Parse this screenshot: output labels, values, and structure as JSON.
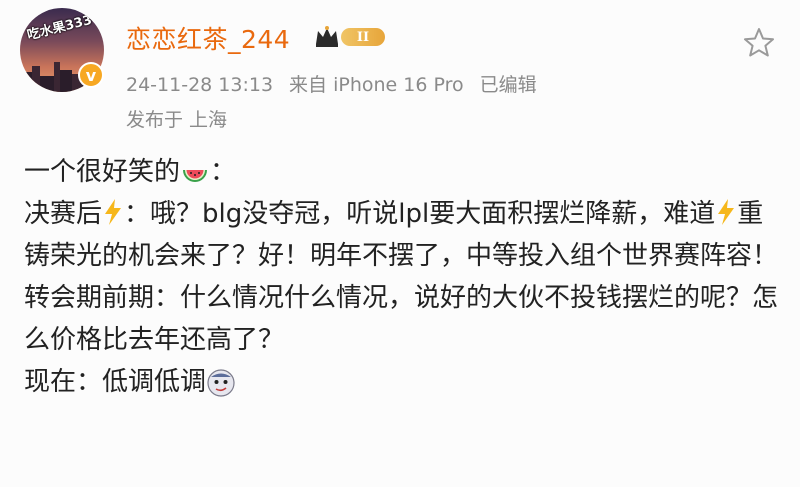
{
  "post": {
    "avatar_text": "吃水果333",
    "username": "恋恋红茶_244",
    "level": "II",
    "verified_mark": "v",
    "date": "24-11-28 13:13",
    "source": "来自 iPhone 16 Pro",
    "edited": "已编辑",
    "location": "发布于 上海"
  },
  "content": {
    "line1_text": "一个很好笑的",
    "line1_suffix": "：",
    "p2_a": "决赛后",
    "p2_b": "：哦？blg没夺冠，听说lpl要大面积摆烂降薪，难道",
    "p2_c": "重铸荣光的机会来了？好！明年不摆了，中等投入组个世界赛阵容！",
    "p3": "转会期前期：什么情况什么情况，说好的大伙不投钱摆烂的呢？怎么价格比去年还高了？",
    "p4": "现在：低调低调"
  },
  "icons": {
    "star": "star-outline-icon",
    "crown": "crown-icon",
    "watermelon": "watermelon-emoji",
    "bolt": "lightning-emoji",
    "sly": "sly-face-emoji"
  },
  "colors": {
    "username": "#e9690e",
    "meta": "#8a8a8a",
    "badge": "#f7a823"
  }
}
